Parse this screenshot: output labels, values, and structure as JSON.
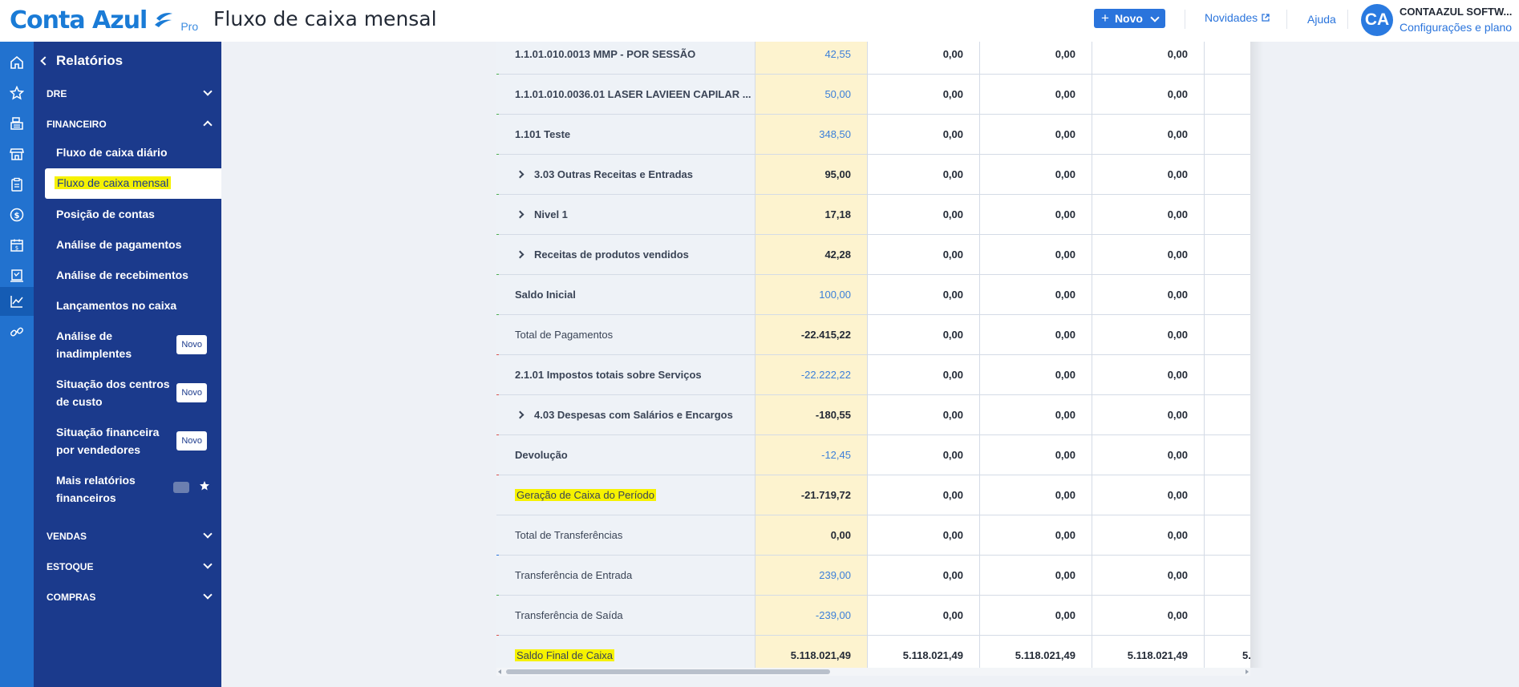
{
  "header": {
    "logo": "Conta Azul",
    "logo_badge": "Pro",
    "title": "Fluxo de caixa mensal",
    "new_button": "Novo",
    "news_link": "Novidades",
    "help_link": "Ajuda",
    "avatar_initials": "CA",
    "company_name": "CONTAAZUL SOFTW...",
    "plan_link": "Configurações e plano"
  },
  "rail": {
    "icons": [
      "home-icon",
      "star-icon",
      "calculator-icon",
      "store-icon",
      "clipboard-icon",
      "dollar-icon",
      "calendar-icon",
      "receipt-icon",
      "chart-icon",
      "link-icon"
    ],
    "active": "chart-icon"
  },
  "sidebar": {
    "title": "Relatórios",
    "sections": {
      "dre": "DRE",
      "financeiro": "FINANCEIRO",
      "vendas": "VENDAS",
      "estoque": "ESTOQUE",
      "compras": "COMPRAS"
    },
    "items": [
      {
        "label": "Fluxo de caixa diário"
      },
      {
        "label": "Fluxo de caixa mensal"
      },
      {
        "label": "Posição de contas"
      },
      {
        "label": "Análise de pagamentos"
      },
      {
        "label": "Análise de recebimentos"
      },
      {
        "label": "Lançamentos no caixa"
      },
      {
        "label_1": "Análise de",
        "label_2": "inadimplentes",
        "badge": "Novo"
      },
      {
        "label_1": "Situação dos centros",
        "label_2": "de custo",
        "badge": "Novo"
      },
      {
        "label_1": "Situação financeira",
        "label_2": "por vendedores",
        "badge": "Novo"
      },
      {
        "label_1": "Mais relatórios",
        "label_2": "financeiros"
      }
    ]
  },
  "table": {
    "rows": [
      {
        "label": "1.1.01.010.0013 MMP - POR SESSÃO",
        "v1": "42,55",
        "v2": "0,00",
        "v3": "0,00",
        "v4": "0,00",
        "v5": ""
      },
      {
        "label": "1.1.01.010.0036.01 LASER LAVIEEN CAPILAR ...",
        "v1": "50,00",
        "v2": "0,00",
        "v3": "0,00",
        "v4": "0,00",
        "v5": ""
      },
      {
        "label": "1.101 Teste",
        "v1": "348,50",
        "v2": "0,00",
        "v3": "0,00",
        "v4": "0,00",
        "v5": ""
      },
      {
        "label": "3.03 Outras Receitas e Entradas",
        "v1": "95,00",
        "v2": "0,00",
        "v3": "0,00",
        "v4": "0,00",
        "v5": ""
      },
      {
        "label": "Nivel 1",
        "v1": "17,18",
        "v2": "0,00",
        "v3": "0,00",
        "v4": "0,00",
        "v5": ""
      },
      {
        "label": "Receitas de produtos vendidos",
        "v1": "42,28",
        "v2": "0,00",
        "v3": "0,00",
        "v4": "0,00",
        "v5": ""
      },
      {
        "label": "Saldo Inicial",
        "v1": "100,00",
        "v2": "0,00",
        "v3": "0,00",
        "v4": "0,00",
        "v5": ""
      },
      {
        "label": "Total de Pagamentos",
        "v1": "-22.415,22",
        "v2": "0,00",
        "v3": "0,00",
        "v4": "0,00",
        "v5": ""
      },
      {
        "label": "2.1.01 Impostos totais sobre Serviços",
        "v1": "-22.222,22",
        "v2": "0,00",
        "v3": "0,00",
        "v4": "0,00",
        "v5": ""
      },
      {
        "label": "4.03 Despesas com Salários e Encargos",
        "v1": "-180,55",
        "v2": "0,00",
        "v3": "0,00",
        "v4": "0,00",
        "v5": ""
      },
      {
        "label": "Devolução",
        "v1": "-12,45",
        "v2": "0,00",
        "v3": "0,00",
        "v4": "0,00",
        "v5": ""
      },
      {
        "label": "Geração de Caixa do Período",
        "v1": "-21.719,72",
        "v2": "0,00",
        "v3": "0,00",
        "v4": "0,00",
        "v5": ""
      },
      {
        "label": "Total de Transferências",
        "v1": "0,00",
        "v2": "0,00",
        "v3": "0,00",
        "v4": "0,00",
        "v5": ""
      },
      {
        "label": "Transferência de Entrada",
        "v1": "239,00",
        "v2": "0,00",
        "v3": "0,00",
        "v4": "0,00",
        "v5": ""
      },
      {
        "label": "Transferência de Saída",
        "v1": "-239,00",
        "v2": "0,00",
        "v3": "0,00",
        "v4": "0,00",
        "v5": ""
      },
      {
        "label": "Saldo Final de Caixa",
        "v1": "5.118.021,49",
        "v2": "5.118.021,49",
        "v3": "5.118.021,49",
        "v4": "5.118.021,49",
        "v5": "5."
      }
    ]
  },
  "colors": {
    "brand": "#1a7bd6",
    "sidebar": "#1b3a8c",
    "rail": "#2272cf",
    "highlight": "#f6f200",
    "current_month": "#fdf3cf",
    "income_indicator": "#4caf50",
    "expense_indicator": "#d9534f",
    "transfer_indicator": "#2a74dc"
  }
}
